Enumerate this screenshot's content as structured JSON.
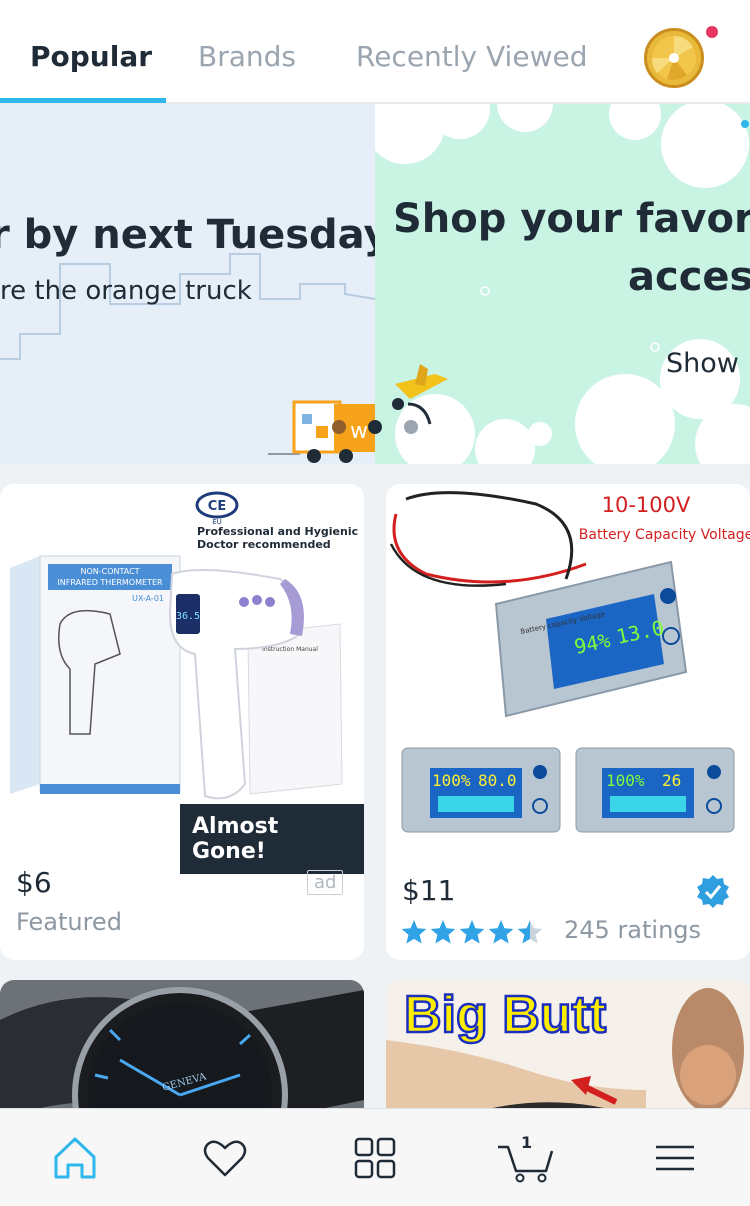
{
  "tabs": [
    {
      "label": "Popular",
      "active": true
    },
    {
      "label": "Brands",
      "active": false
    },
    {
      "label": "Recently Viewed",
      "active": false
    }
  ],
  "colors": {
    "accent": "#2fb7ec",
    "text_dark": "#1f2b36",
    "text_muted": "#9aa5b0",
    "notification": "#e8355b",
    "truck_orange": "#f7a21b"
  },
  "banners": [
    {
      "title": "r by next Tuesday!",
      "subtitle": "re the orange truck"
    },
    {
      "title_line1": "Shop your favorit",
      "title_line2": "acces",
      "link": "Show I"
    }
  ],
  "products": [
    {
      "price": "$6",
      "label": "Featured",
      "ad_tag": "ad",
      "badge": "Almost Gone!",
      "image_text": {
        "cert": "CE",
        "cert_sub": "EU",
        "tagline1": "Professional and Hygienic",
        "tagline2": "Doctor recommended",
        "box_title1": "NON-CONTACT",
        "box_title2": "INFRARED THERMOMETER",
        "model": "UX-A-01",
        "display": "36.5",
        "manual": "Instruction Manual"
      }
    },
    {
      "price": "$11",
      "rating": 4.5,
      "ratings_label": "245 ratings",
      "verified": true,
      "image_text": {
        "range": "10-100V",
        "caption": "Battery Capacity Voltage",
        "main_pct": "94%",
        "main_v": "13.0",
        "small1_pct": "100%",
        "small1_v": "80.0",
        "small2_pct": "100%",
        "small2_t": "26",
        "panel_label": "Battery capacity Voltage"
      }
    },
    {
      "image_text": {
        "brand": "GENEVA"
      }
    },
    {
      "image_text": {
        "headline": "Big Butt"
      }
    }
  ],
  "bottom_nav": [
    {
      "icon": "home-icon",
      "active": true
    },
    {
      "icon": "heart-icon",
      "active": false
    },
    {
      "icon": "categories-grid-icon",
      "active": false
    },
    {
      "icon": "cart-icon",
      "active": false,
      "count": "1"
    },
    {
      "icon": "menu-icon",
      "active": false
    }
  ]
}
